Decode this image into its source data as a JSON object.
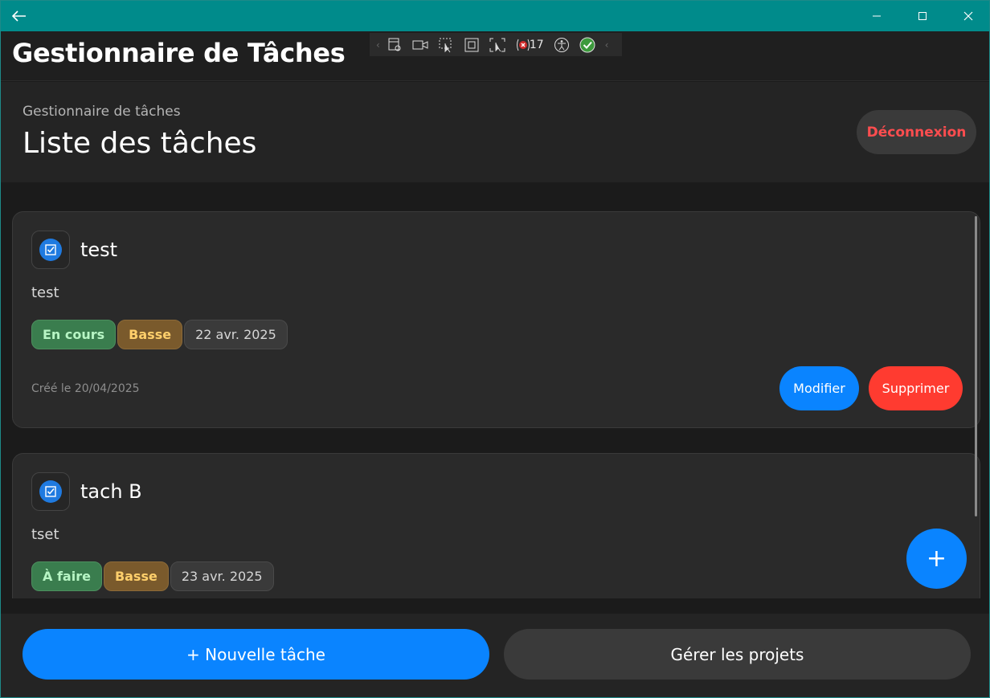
{
  "window": {
    "back_icon": "arrow-left-icon",
    "controls": [
      "minimize-icon",
      "maximize-icon",
      "close-icon"
    ]
  },
  "app": {
    "title": "Gestionnaire de Tâches"
  },
  "debug_toolbar": {
    "icons": [
      "live-visual-tree-icon",
      "video-icon",
      "select-element-icon",
      "display-layout-adorners-icon",
      "track-focus-icon",
      "binding-failures-icon",
      "accessibility-icon",
      "hot-reload-ok-icon"
    ],
    "binding_failures_count": "17"
  },
  "page": {
    "subtitle": "Gestionnaire de tâches",
    "title": "Liste des tâches",
    "logout_label": "Déconnexion"
  },
  "tasks": [
    {
      "title": "test",
      "description": "test",
      "status": "En cours",
      "priority": "Basse",
      "due_date": "22 avr. 2025",
      "created": "Créé le 20/04/2025",
      "edit_label": "Modifier",
      "delete_label": "Supprimer"
    },
    {
      "title": "tach B",
      "description": "tset",
      "status": "À faire",
      "priority": "Basse",
      "due_date": "23 avr. 2025"
    }
  ],
  "fab": {
    "label": "+"
  },
  "bottom": {
    "new_task_label": "+ Nouvelle tâche",
    "projects_label": "Gérer les projets"
  },
  "colors": {
    "titlebar": "#008b8b",
    "accent": "#0a84ff",
    "danger": "#ff3b30",
    "logout_text": "#ff4d4f",
    "status_green": "#3a7d4e",
    "priority_brown": "#7a5a2c"
  }
}
